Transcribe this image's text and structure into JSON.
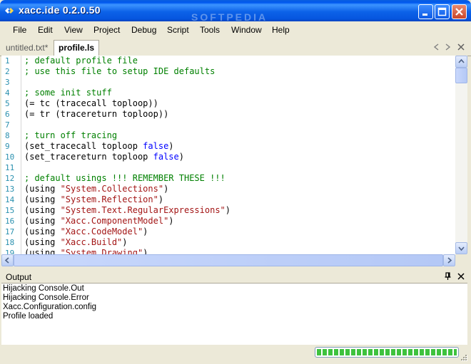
{
  "window": {
    "title": "xacc.ide 0.2.0.50",
    "watermark": "SOFTPEDIA"
  },
  "menu": [
    "File",
    "Edit",
    "View",
    "Project",
    "Debug",
    "Script",
    "Tools",
    "Window",
    "Help"
  ],
  "tabs": [
    {
      "label": "untitled.txt*",
      "active": false
    },
    {
      "label": "profile.ls",
      "active": true
    }
  ],
  "editor": {
    "lines": [
      {
        "num": "1",
        "parts": [
          {
            "t": "; default profile file",
            "c": "cm"
          }
        ]
      },
      {
        "num": "2",
        "parts": [
          {
            "t": "; use this file to setup IDE defaults",
            "c": "cm"
          }
        ]
      },
      {
        "num": "3",
        "parts": []
      },
      {
        "num": "4",
        "parts": [
          {
            "t": "; some init stuff",
            "c": "cm"
          }
        ]
      },
      {
        "num": "5",
        "parts": [
          {
            "t": "(= tc (tracecall toploop))",
            "c": ""
          }
        ]
      },
      {
        "num": "6",
        "parts": [
          {
            "t": "(= tr (tracereturn toploop))",
            "c": ""
          }
        ]
      },
      {
        "num": "7",
        "parts": []
      },
      {
        "num": "8",
        "parts": [
          {
            "t": "; turn off tracing",
            "c": "cm"
          }
        ]
      },
      {
        "num": "9",
        "parts": [
          {
            "t": "(set_tracecall toploop ",
            "c": ""
          },
          {
            "t": "false",
            "c": "kw"
          },
          {
            "t": ")",
            "c": ""
          }
        ]
      },
      {
        "num": "10",
        "parts": [
          {
            "t": "(set_tracereturn toploop ",
            "c": ""
          },
          {
            "t": "false",
            "c": "kw"
          },
          {
            "t": ")",
            "c": ""
          }
        ]
      },
      {
        "num": "11",
        "parts": []
      },
      {
        "num": "12",
        "parts": [
          {
            "t": "; default usings !!! REMEMBER THESE !!!",
            "c": "cm"
          }
        ]
      },
      {
        "num": "13",
        "parts": [
          {
            "t": "(using ",
            "c": ""
          },
          {
            "t": "\"System.Collections\"",
            "c": "st"
          },
          {
            "t": ")",
            "c": ""
          }
        ]
      },
      {
        "num": "14",
        "parts": [
          {
            "t": "(using ",
            "c": ""
          },
          {
            "t": "\"System.Reflection\"",
            "c": "st"
          },
          {
            "t": ")",
            "c": ""
          }
        ]
      },
      {
        "num": "15",
        "parts": [
          {
            "t": "(using ",
            "c": ""
          },
          {
            "t": "\"System.Text.RegularExpressions\"",
            "c": "st"
          },
          {
            "t": ")",
            "c": ""
          }
        ]
      },
      {
        "num": "16",
        "parts": [
          {
            "t": "(using ",
            "c": ""
          },
          {
            "t": "\"Xacc.ComponentModel\"",
            "c": "st"
          },
          {
            "t": ")",
            "c": ""
          }
        ]
      },
      {
        "num": "17",
        "parts": [
          {
            "t": "(using ",
            "c": ""
          },
          {
            "t": "\"Xacc.CodeModel\"",
            "c": "st"
          },
          {
            "t": ")",
            "c": ""
          }
        ]
      },
      {
        "num": "18",
        "parts": [
          {
            "t": "(using ",
            "c": ""
          },
          {
            "t": "\"Xacc.Build\"",
            "c": "st"
          },
          {
            "t": ")",
            "c": ""
          }
        ]
      },
      {
        "num": "19",
        "parts": [
          {
            "t": "(using ",
            "c": ""
          },
          {
            "t": "\"System.Drawing\"",
            "c": "st"
          },
          {
            "t": ")",
            "c": ""
          }
        ]
      }
    ]
  },
  "output": {
    "title": "Output",
    "lines": [
      "Hijacking Console.Out",
      "Hijacking Console.Error",
      "Xacc.Configuration.config",
      "Profile loaded"
    ]
  },
  "status": {
    "progress_fraction": 1.0
  },
  "colors": {
    "comment": "#008000",
    "keyword": "#0000ff",
    "string": "#a31515",
    "line_number": "#2b91af",
    "progress": "#3ec23e"
  },
  "icons": [
    "app-icon",
    "minimize-icon",
    "maximize-icon",
    "close-icon",
    "tab-prev-icon",
    "tab-next-icon",
    "pin-icon",
    "panel-close-icon",
    "scroll-up-icon",
    "scroll-down-icon",
    "scroll-left-icon",
    "scroll-right-icon",
    "resize-grip-icon"
  ]
}
